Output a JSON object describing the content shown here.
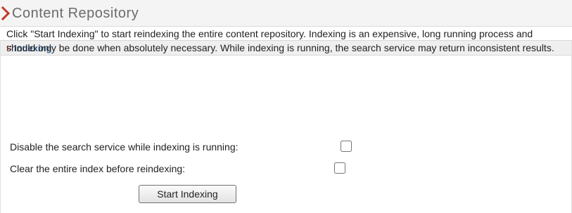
{
  "page": {
    "title": "Content Repository"
  },
  "panel": {
    "title": "Indexing",
    "description": "Click \"Start Indexing\" to start reindexing the entire content repository. Indexing is an expensive, long running process and should only be done when absolutely necessary. While indexing is running, the search service may return inconsistent results."
  },
  "options": [
    {
      "label": "Disable the search service while indexing is running:",
      "checked": false
    },
    {
      "label": "Clear the entire index before reindexing:",
      "checked": false
    }
  ],
  "actions": {
    "start_label": "Start Indexing"
  },
  "colors": {
    "accent_red": "#c0392b",
    "panel_title_blue": "#2a5a8a"
  },
  "icons": {
    "header_marker": "chevron-right-icon",
    "panel_marker": "grip-dots-icon"
  }
}
